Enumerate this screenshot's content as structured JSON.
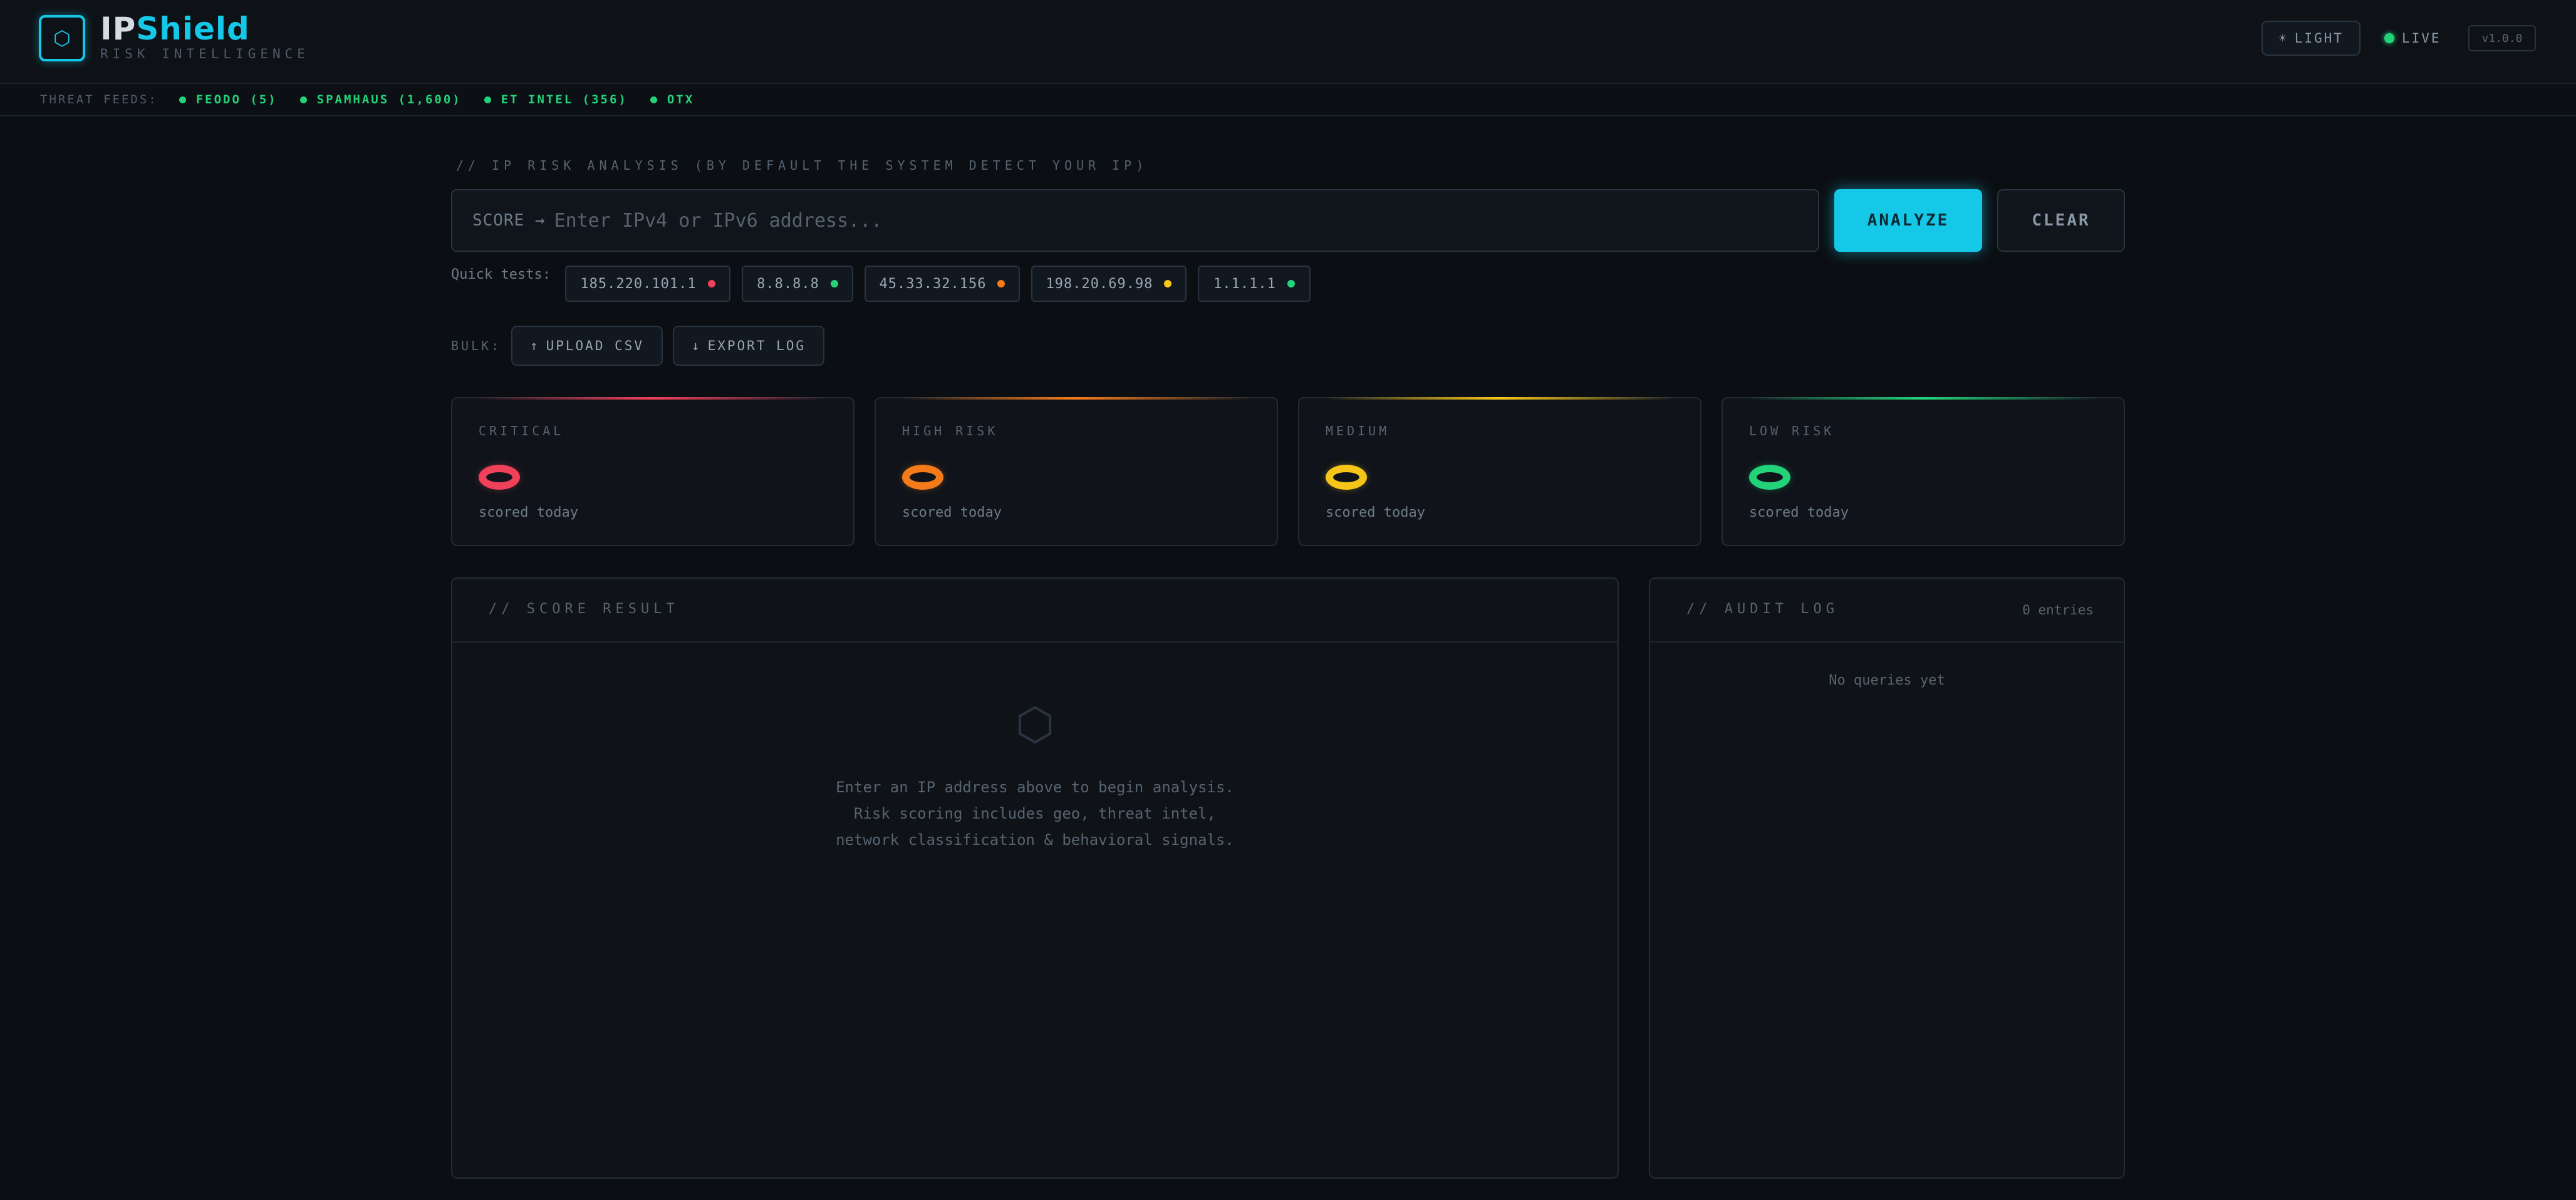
{
  "header": {
    "logo_glyph": "⬡",
    "brand_ip": "IP",
    "brand_shield": "Shield",
    "subtitle": "RISK INTELLIGENCE",
    "theme_icon": "☀",
    "theme_label": "LIGHT",
    "live_label": "LIVE",
    "version": "v1.0.0"
  },
  "feeds": {
    "label": "THREAT FEEDS:",
    "items": [
      "FEODO (5)",
      "SPAMHAUS (1,600)",
      "ET INTEL (356)",
      "OTX"
    ],
    "status_color": "#22d37a"
  },
  "analysis": {
    "section_title": "// IP RISK ANALYSIS (BY DEFAULT THE SYSTEM DETECT YOUR IP)",
    "search_prefix": "SCORE →",
    "search_placeholder": "Enter IPv4 or IPv6 address...",
    "search_value": "",
    "analyze_label": "ANALYZE",
    "clear_label": "CLEAR",
    "quick_label": "Quick tests:",
    "quick_tests": [
      {
        "ip": "185.220.101.1",
        "color": "#f0405a"
      },
      {
        "ip": "8.8.8.8",
        "color": "#22d37a"
      },
      {
        "ip": "45.33.32.156",
        "color": "#f47a1a"
      },
      {
        "ip": "198.20.69.98",
        "color": "#f5c518"
      },
      {
        "ip": "1.1.1.1",
        "color": "#22d37a"
      }
    ],
    "bulk_label": "BULK:",
    "upload_icon": "↑",
    "upload_label": "UPLOAD CSV",
    "export_icon": "↓",
    "export_label": "EXPORT LOG"
  },
  "risk_cards": [
    {
      "label": "CRITICAL",
      "value": 0,
      "sub": "scored today",
      "color": "#f0405a"
    },
    {
      "label": "HIGH RISK",
      "value": 0,
      "sub": "scored today",
      "color": "#f47a1a"
    },
    {
      "label": "MEDIUM",
      "value": 0,
      "sub": "scored today",
      "color": "#f5c518"
    },
    {
      "label": "LOW RISK",
      "value": 0,
      "sub": "scored today",
      "color": "#22d37a"
    }
  ],
  "score_panel": {
    "title": "// SCORE RESULT",
    "empty_icon": "⬡",
    "empty_lines": [
      "Enter an IP address above to begin analysis.",
      "Risk scoring includes geo, threat intel,",
      "network classification & behavioral signals."
    ]
  },
  "audit_panel": {
    "title": "// AUDIT LOG",
    "count": "0 entries",
    "empty": "No queries yet"
  }
}
